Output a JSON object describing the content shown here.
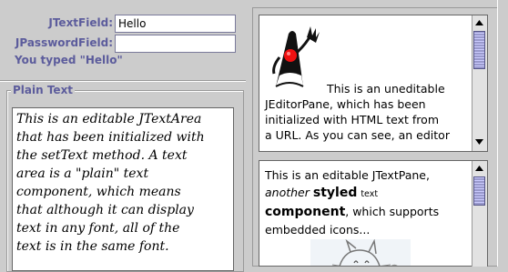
{
  "form": {
    "jtextfield_label": "JTextField:",
    "jtextfield_value": "Hello",
    "jpassword_label": "JPasswordField:",
    "jpassword_value": "",
    "typed_message": "You typed \"Hello\""
  },
  "plain_text": {
    "title": "Plain Text",
    "lines": [
      "This is an editable JTextArea",
      "that has been initialized with",
      "the setText method. A text",
      "area is a \"plain\" text",
      "component, which means",
      "that although it can display",
      "text in any font, all of the",
      "text is in the same font."
    ]
  },
  "editor_pane": {
    "line1": "This is an uneditable",
    "line2": "JEditorPane, which has been",
    "line3": "initialized with HTML text from",
    "line4": "a URL. As you can see, an editor",
    "image_icon": "duke-waving-icon",
    "scroll_fraction": 0.0
  },
  "text_pane": {
    "seg1": "This is an editable JTextPane,",
    "seg2_italic": "another",
    "seg3_bold": "styled",
    "seg4_small": "text",
    "seg5_large_bold": "component",
    "seg6": ", which supports",
    "seg7": "embedded icons...",
    "image_icon": "cat-sketch-icon",
    "scroll_fraction": 0.0
  },
  "colors": {
    "background": "#cccccc",
    "label_color": "#5c5c9c",
    "scroll_thumb": "#9999cc"
  }
}
